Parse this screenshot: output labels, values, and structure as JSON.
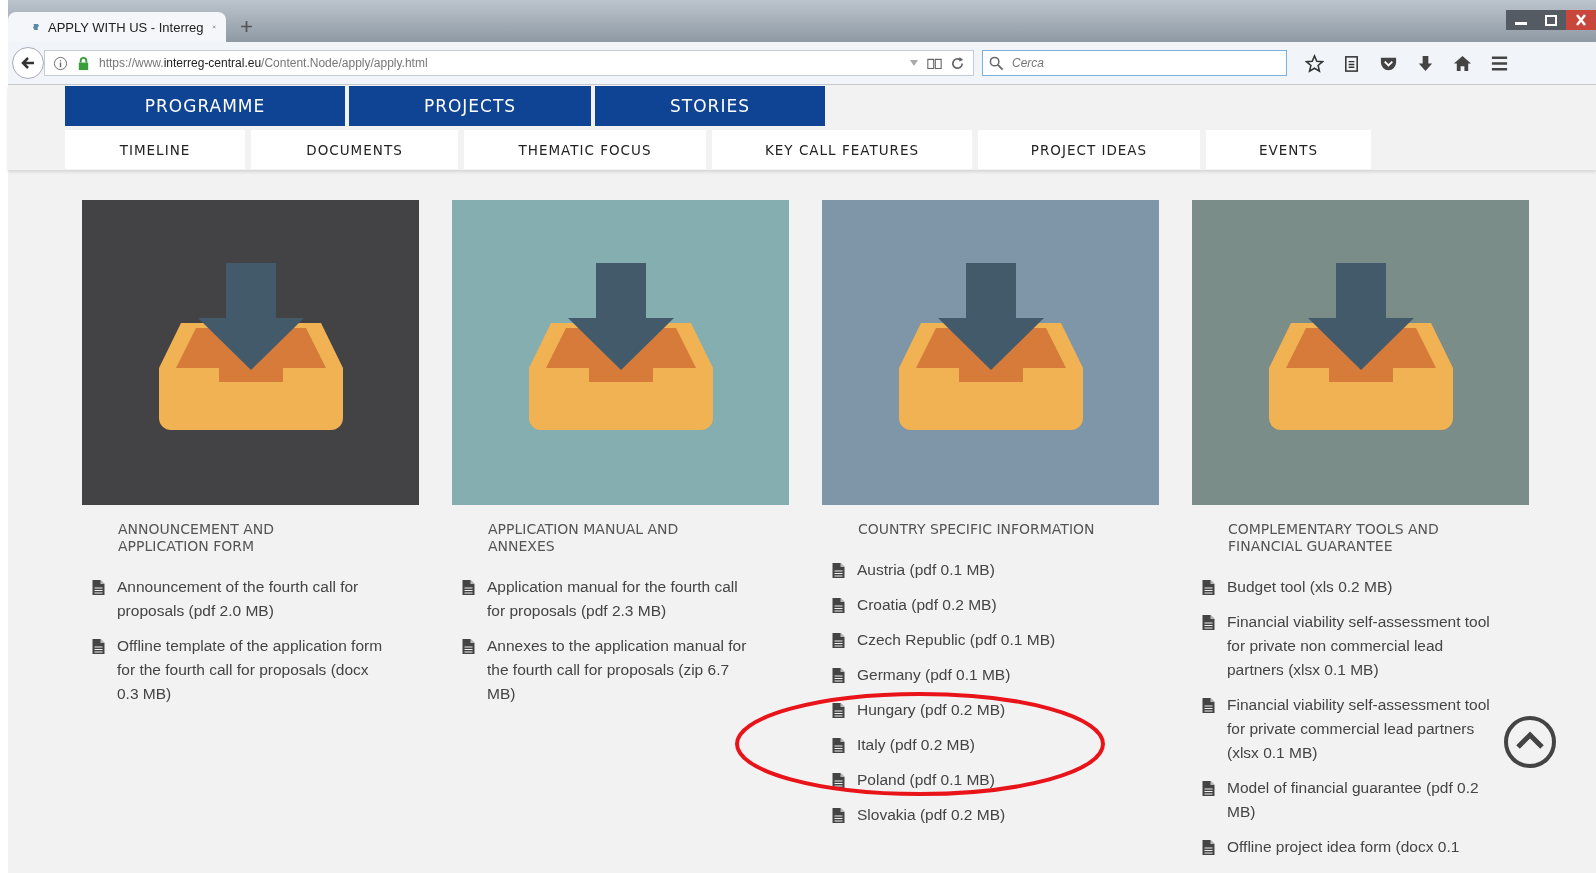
{
  "browser": {
    "tab_title": "APPLY WITH US - Interreg",
    "url": "https://www.**interreg-central.eu**/Content.Node/apply/apply.html",
    "search": {
      "placeholder": "Cerca"
    }
  },
  "main_nav": [
    {
      "label": "PROGRAMME"
    },
    {
      "label": "PROJECTS"
    },
    {
      "label": "STORIES"
    }
  ],
  "sub_nav": [
    {
      "label": "TIMELINE"
    },
    {
      "label": "DOCUMENTS"
    },
    {
      "label": "THEMATIC FOCUS"
    },
    {
      "label": "KEY CALL FEATURES"
    },
    {
      "label": "PROJECT IDEAS"
    },
    {
      "label": "EVENTS"
    }
  ],
  "sections": [
    {
      "title": "ANNOUNCEMENT AND APPLICATION FORM",
      "color": "#434345",
      "items": [
        "Announcement of the fourth call for proposals (pdf 2.0 MB)",
        "Offline template of the application form for the fourth call for proposals (docx 0.3 MB)"
      ]
    },
    {
      "title": "APPLICATION MANUAL AND ANNEXES",
      "color": "#85aeb0",
      "items": [
        "Application manual for the fourth call for proposals (pdf 2.3 MB)",
        "Annexes to the application manual for the fourth call for proposals (zip 6.7 MB)"
      ]
    },
    {
      "title": "COUNTRY SPECIFIC INFORMATION",
      "color": "#7f96a9",
      "items": [
        "Austria (pdf 0.1 MB)",
        "Croatia (pdf 0.2 MB)",
        "Czech Republic (pdf 0.1 MB)",
        "Germany (pdf 0.1 MB)",
        "Hungary (pdf 0.2 MB)",
        "Italy (pdf 0.2 MB)",
        "Poland (pdf 0.1 MB)",
        "Slovakia (pdf 0.2 MB)"
      ]
    },
    {
      "title": "COMPLEMENTARY TOOLS AND FINANCIAL GUARANTEE",
      "color": "#7b8d89",
      "items": [
        "Budget tool (xls 0.2 MB)",
        "Financial viability self-assessment tool for private non commercial lead partners (xlsx 0.1 MB)",
        "Financial viability self-assessment tool for private commercial lead partners (xlsx 0.1 MB)",
        "Model of financial guarantee (pdf 0.2 MB)",
        "Offline project idea form (docx 0.1"
      ]
    }
  ]
}
